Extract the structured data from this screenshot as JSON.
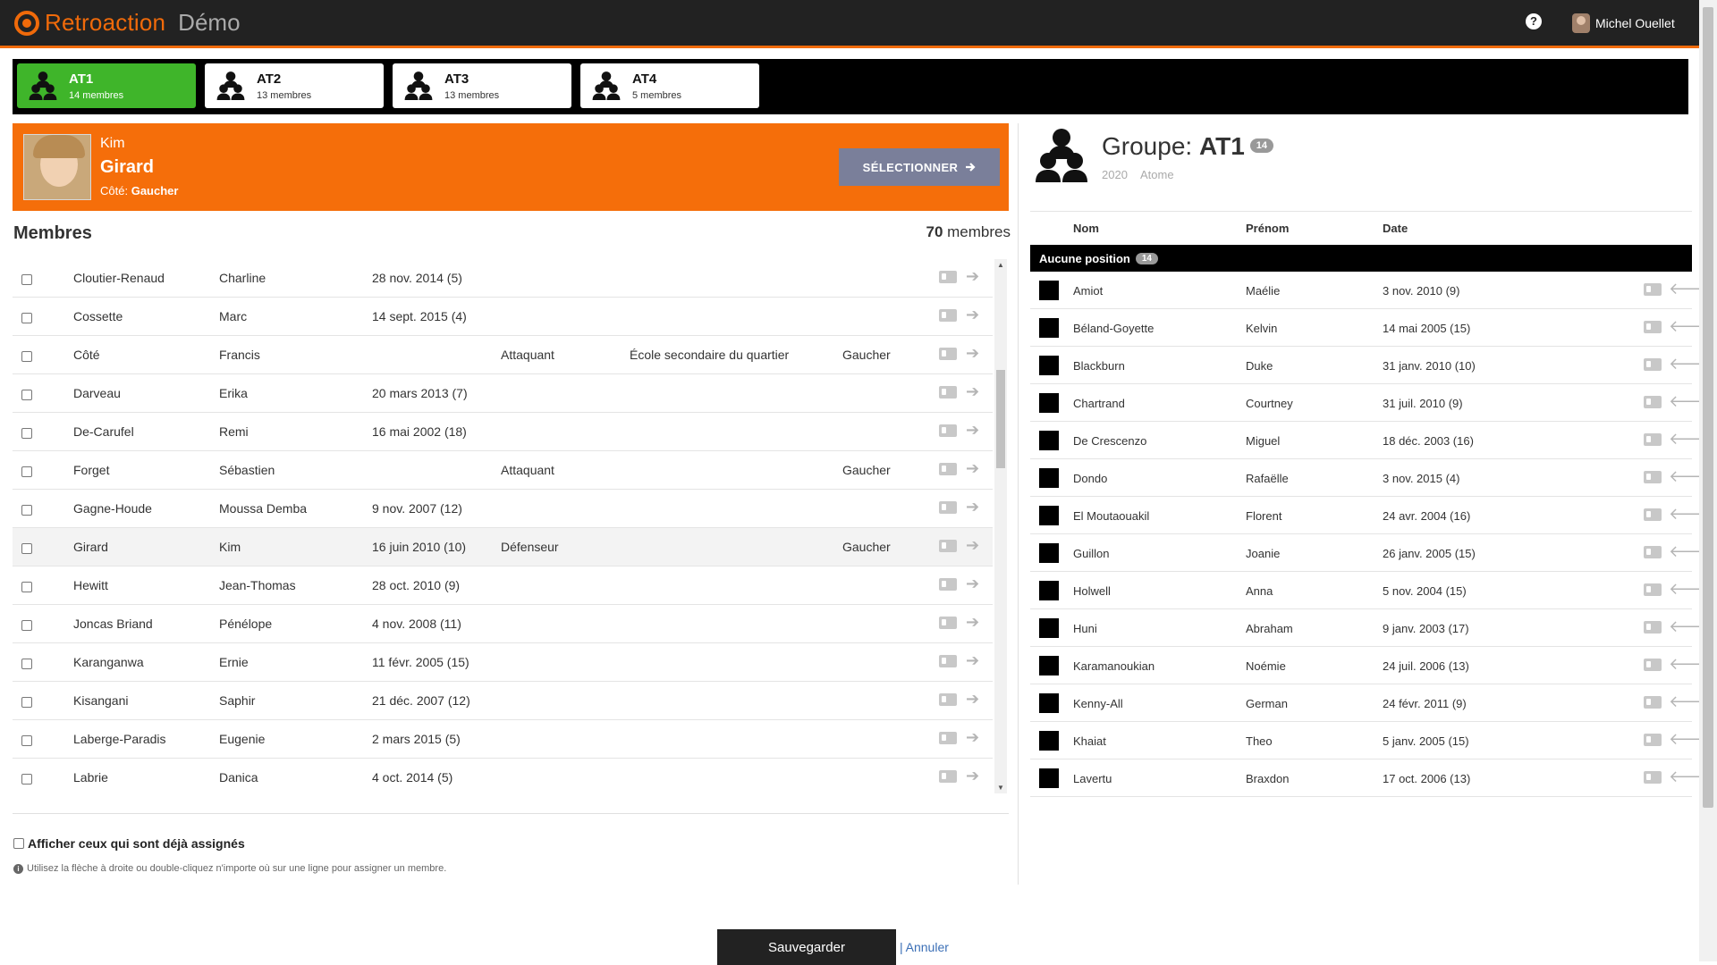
{
  "app": {
    "brand": "Retroaction",
    "env": "Démo"
  },
  "header": {
    "help": "?",
    "user_name": "Michel Ouellet"
  },
  "groups": [
    {
      "name": "AT1",
      "count": "14 membres",
      "active": true
    },
    {
      "name": "AT2",
      "count": "13 membres",
      "active": false
    },
    {
      "name": "AT3",
      "count": "13 membres",
      "active": false
    },
    {
      "name": "AT4",
      "count": "5 membres",
      "active": false
    }
  ],
  "selected": {
    "first_name": "Kim",
    "last_name": "Girard",
    "side_label": "Côté:",
    "side_value": "Gaucher",
    "select_label": "SÉLECTIONNER"
  },
  "members": {
    "title": "Membres",
    "count": "70",
    "count_label": "membres",
    "rows": [
      {
        "last": "Cloutier-Renaud",
        "first": "Charline",
        "date": "28 nov. 2014 (5)",
        "position": "",
        "school": "",
        "side": ""
      },
      {
        "last": "Cossette",
        "first": "Marc",
        "date": "14 sept. 2015 (4)",
        "position": "",
        "school": "",
        "side": ""
      },
      {
        "last": "Côté",
        "first": "Francis",
        "date": "",
        "position": "Attaquant",
        "school": "École secondaire du quartier",
        "side": "Gaucher"
      },
      {
        "last": "Darveau",
        "first": "Erika",
        "date": "20 mars 2013 (7)",
        "position": "",
        "school": "",
        "side": ""
      },
      {
        "last": "De-Carufel",
        "first": "Remi",
        "date": "16 mai 2002 (18)",
        "position": "",
        "school": "",
        "side": ""
      },
      {
        "last": "Forget",
        "first": "Sébastien",
        "date": "",
        "position": "Attaquant",
        "school": "",
        "side": "Gaucher"
      },
      {
        "last": "Gagne-Houde",
        "first": "Moussa Demba",
        "date": "9 nov. 2007 (12)",
        "position": "",
        "school": "",
        "side": ""
      },
      {
        "last": "Girard",
        "first": "Kim",
        "date": "16 juin 2010 (10)",
        "position": "Défenseur",
        "school": "",
        "side": "Gaucher"
      },
      {
        "last": "Hewitt",
        "first": "Jean-Thomas",
        "date": "28 oct. 2010 (9)",
        "position": "",
        "school": "",
        "side": ""
      },
      {
        "last": "Joncas Briand",
        "first": "Pénélope",
        "date": "4 nov. 2008 (11)",
        "position": "",
        "school": "",
        "side": ""
      },
      {
        "last": "Karanganwa",
        "first": "Ernie",
        "date": "11 févr. 2005 (15)",
        "position": "",
        "school": "",
        "side": ""
      },
      {
        "last": "Kisangani",
        "first": "Saphir",
        "date": "21 déc. 2007 (12)",
        "position": "",
        "school": "",
        "side": ""
      },
      {
        "last": "Laberge-Paradis",
        "first": "Eugenie",
        "date": "2 mars 2015 (5)",
        "position": "",
        "school": "",
        "side": ""
      },
      {
        "last": "Labrie",
        "first": "Danica",
        "date": "4 oct. 2014 (5)",
        "position": "",
        "school": "",
        "side": ""
      }
    ]
  },
  "show_assigned_label": "Afficher ceux qui sont déjà assignés",
  "hint": "Utilisez la flèche à droite ou double-cliquez n'importe où sur une ligne pour assigner un membre.",
  "group_panel": {
    "title_prefix": "Groupe:",
    "name": "AT1",
    "badge": "14",
    "year": "2020",
    "category": "Atome",
    "headers": {
      "last": "Nom",
      "first": "Prénom",
      "date": "Date"
    },
    "position_label": "Aucune position",
    "position_count": "14",
    "rows": [
      {
        "last": "Amiot",
        "first": "Maélie",
        "date": "3 nov. 2010 (9)"
      },
      {
        "last": "Béland-Goyette",
        "first": "Kelvin",
        "date": "14 mai 2005 (15)"
      },
      {
        "last": "Blackburn",
        "first": "Duke",
        "date": "31 janv. 2010 (10)"
      },
      {
        "last": "Chartrand",
        "first": "Courtney",
        "date": "31 juil. 2010 (9)"
      },
      {
        "last": "De Crescenzo",
        "first": "Miguel",
        "date": "18 déc. 2003 (16)"
      },
      {
        "last": "Dondo",
        "first": "Rafaëlle",
        "date": "3 nov. 2015 (4)"
      },
      {
        "last": "El Moutaouakil",
        "first": "Florent",
        "date": "24 avr. 2004 (16)"
      },
      {
        "last": "Guillon",
        "first": "Joanie",
        "date": "26 janv. 2005 (15)"
      },
      {
        "last": "Holwell",
        "first": "Anna",
        "date": "5 nov. 2004 (15)"
      },
      {
        "last": "Huni",
        "first": "Abraham",
        "date": "9 janv. 2003 (17)"
      },
      {
        "last": "Karamanoukian",
        "first": "Noémie",
        "date": "24 juil. 2006 (13)"
      },
      {
        "last": "Kenny-All",
        "first": "German",
        "date": "24 févr. 2011 (9)"
      },
      {
        "last": "Khaiat",
        "first": "Theo",
        "date": "5 janv. 2005 (15)"
      },
      {
        "last": "Lavertu",
        "first": "Braxdon",
        "date": "17 oct. 2006 (13)"
      }
    ]
  },
  "footer": {
    "save_label": "Sauvegarder",
    "cancel_label": "Annuler"
  },
  "colors": {
    "brand": "#f06a0a",
    "active_group": "#3fb52a",
    "banner": "#f56e0a",
    "select_button": "#7a7f9a"
  },
  "icons": {
    "group": "users-icon",
    "card": "id-card-icon",
    "assign": "arrow-right-icon",
    "unassign": "arrow-left-icon"
  }
}
